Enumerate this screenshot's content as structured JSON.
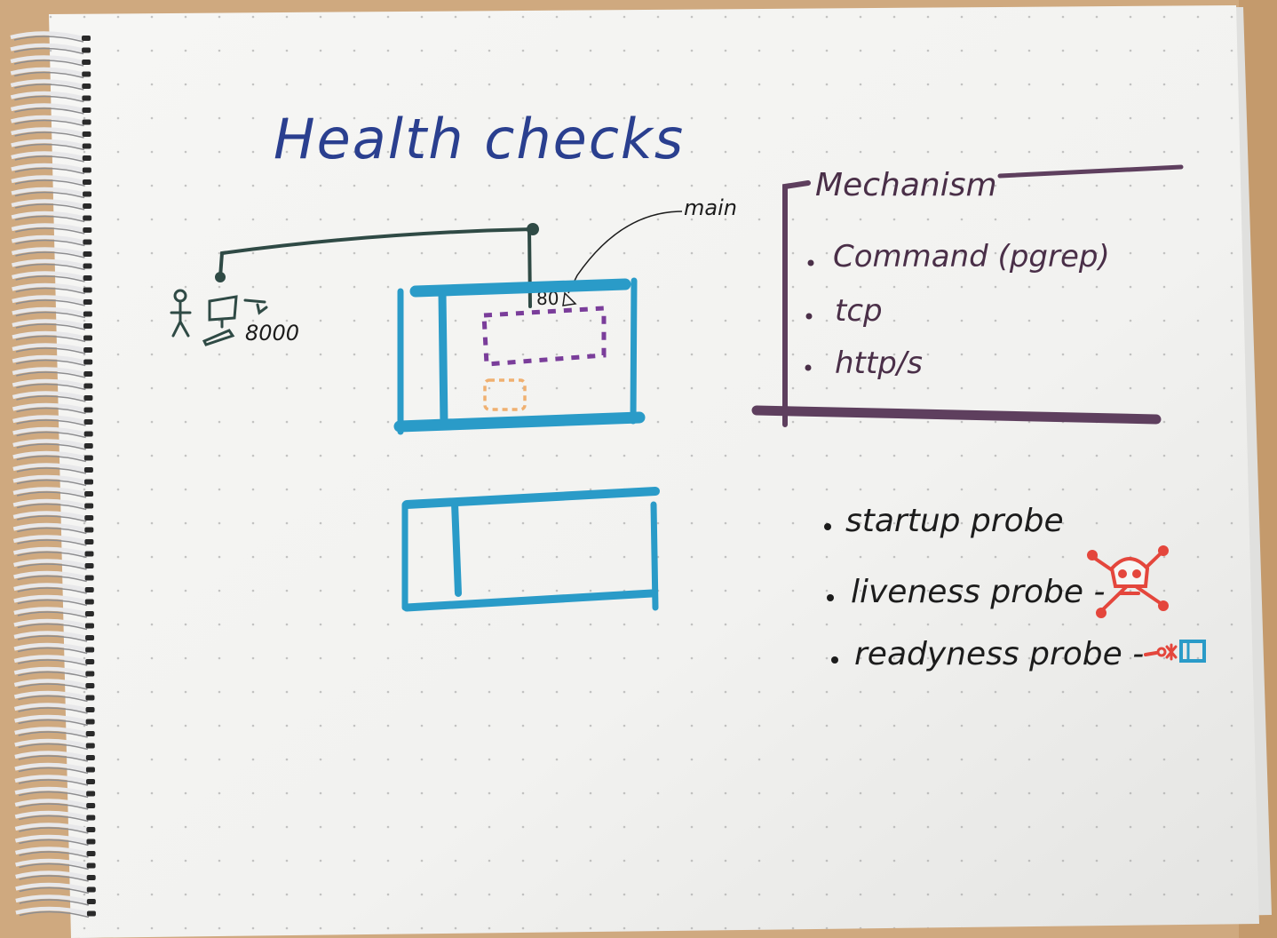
{
  "page": {
    "title": "Health checks"
  },
  "diagram": {
    "client_port": "8000",
    "container_port": "80",
    "container_label": "main"
  },
  "mechanism": {
    "heading": "Mechanism",
    "items": [
      {
        "label": "Command (pgrep)"
      },
      {
        "label": "tcp"
      },
      {
        "label": "http/s"
      }
    ]
  },
  "probes": {
    "items": [
      {
        "label": "startup probe"
      },
      {
        "label": "liveness probe -",
        "icon": "skull-crossbones-icon"
      },
      {
        "label": "readyness probe -",
        "icon": "traffic-into-box-icon"
      }
    ]
  },
  "colors": {
    "title_ink": "#2a3f8f",
    "black_ink": "#1c1c1c",
    "dark_green_ink": "#2f4a45",
    "container_blue": "#2a9bc8",
    "dashed_purple": "#7a3d9a",
    "dashed_orange": "#f0b070",
    "mechanism_purple": "#5e3f5e",
    "skull_red": "#e4463c",
    "ready_blue": "#2a9bc8"
  }
}
